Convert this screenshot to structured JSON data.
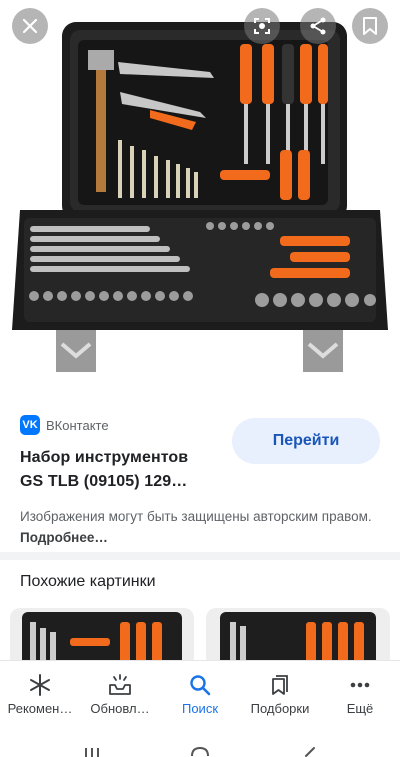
{
  "header": {
    "close_icon": "close-icon",
    "lens_icon": "lens-icon",
    "share_icon": "share-icon",
    "save_icon": "bookmark-icon"
  },
  "result": {
    "source_name": "ВКонтакте",
    "source_logo": "VK",
    "visit_label": "Перейти",
    "title_line1": "Набор инструментов",
    "title_line2": "GS TLB (09105) 129…",
    "notice_text": "Изображения могут быть защищены авторским правом.",
    "notice_more": "Подробнее…"
  },
  "similar": {
    "heading": "Похожие картинки"
  },
  "bottom_nav": [
    {
      "label": "Рекомен…",
      "icon": "asterisk-icon"
    },
    {
      "label": "Обновл…",
      "icon": "updates-icon"
    },
    {
      "label": "Поиск",
      "icon": "search-icon",
      "active": true
    },
    {
      "label": "Подборки",
      "icon": "collections-icon"
    },
    {
      "label": "Ещё",
      "icon": "more-icon"
    }
  ],
  "colors": {
    "accent": "#1a73e8",
    "visit_bg": "#e8f0fe",
    "vk_blue": "#0077ff",
    "tool_orange": "#f26a1b"
  }
}
